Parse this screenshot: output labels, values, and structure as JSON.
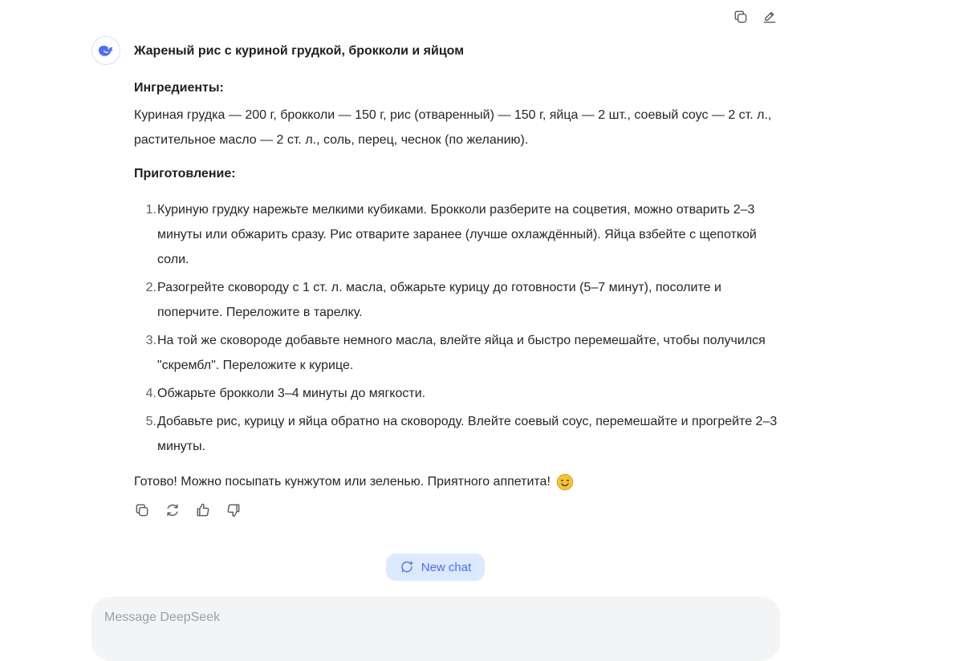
{
  "toolbar_icons": {
    "copy": "copy-icon",
    "edit": "edit-pencil-icon"
  },
  "assistant": {
    "avatar_icon": "deepseek-whale-logo",
    "title": "Жареный рис с куриной грудкой, брокколи и яйцом",
    "ingredients_heading": "Ингредиенты:",
    "ingredients_text": "Куриная грудка — 200 г, брокколи — 150 г, рис (отваренный) — 150 г, яйца — 2 шт., соевый соус — 2 ст. л., растительное масло — 2 ст. л., соль, перец, чеснок (по желанию).",
    "preparation_heading": "Приготовление:",
    "steps": [
      {
        "num": "1.",
        "text": "Куриную грудку нарежьте мелкими кубиками. Брокколи разберите на соцветия, можно отварить 2–3 минуты или обжарить сразу. Рис отварите заранее (лучше охлаждённый). Яйца взбейте с щепоткой соли."
      },
      {
        "num": "2.",
        "text": "Разогрейте сковороду с 1 ст. л. масла, обжарьте курицу до готовности (5–7 минут), посолите и поперчите. Переложите в тарелку."
      },
      {
        "num": "3.",
        "text": "На той же сковороде добавьте немного масла, влейте яйца и быстро перемешайте, чтобы получился \"скрембл\". Переложите к курице."
      },
      {
        "num": "4.",
        "text": "Обжарьте брокколи 3–4 минуты до мягкости."
      },
      {
        "num": "5.",
        "text": "Добавьте рис, курицу и яйца обратно на сковороду. Влейте соевый соус, перемешайте и прогрейте 2–3 минуты."
      }
    ],
    "closing": "Готово! Можно посыпать кунжутом или зеленью. Приятного аппетита!",
    "closing_emoji": "smiling-face-emoji",
    "actions": [
      "copy-icon",
      "regenerate-icon",
      "thumbs-up-icon",
      "thumbs-down-icon"
    ]
  },
  "new_chat": {
    "label": "New chat",
    "icon": "new-chat-icon"
  },
  "composer": {
    "placeholder": "Message DeepSeek",
    "value": ""
  },
  "colors": {
    "accent": "#4d6bfe",
    "pill_bg": "#dbeafe",
    "composer_bg": "#f3f4f6",
    "text": "#262626"
  }
}
